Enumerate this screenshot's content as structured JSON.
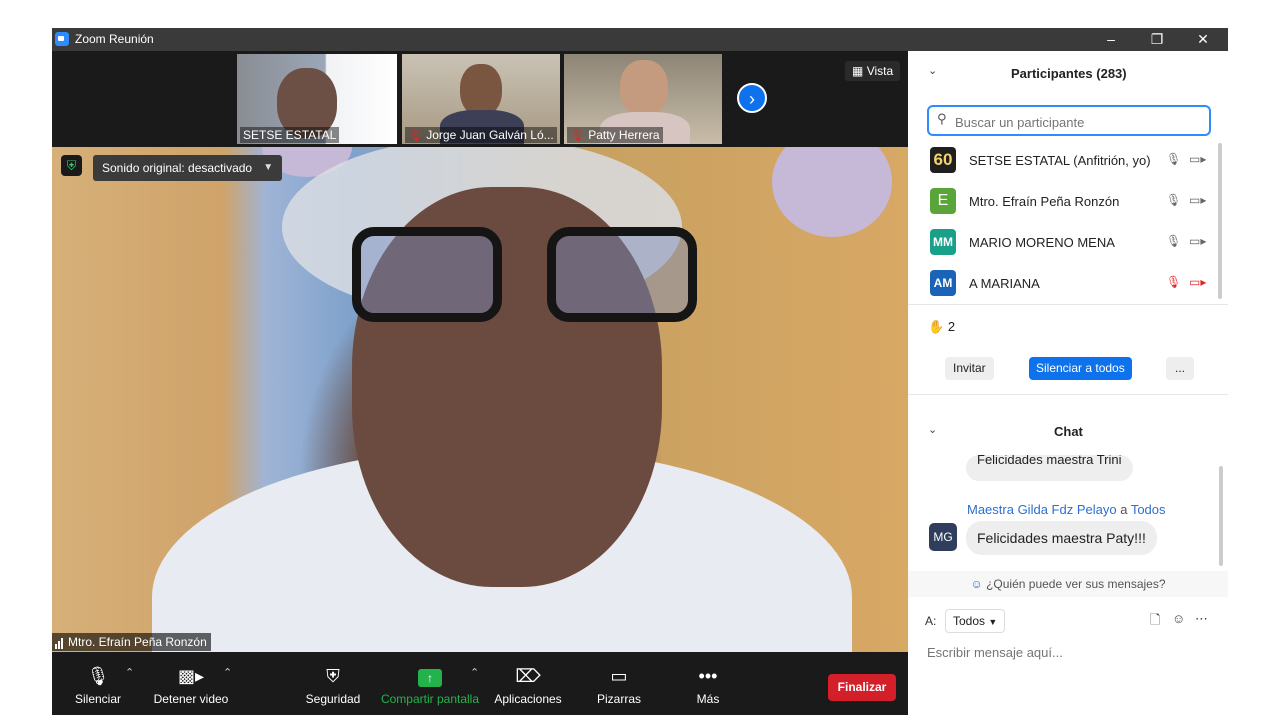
{
  "window": {
    "title": "Zoom Reunión"
  },
  "thumbnails": [
    {
      "name": "SETSE ESTATAL",
      "muted": false
    },
    {
      "name": "Jorge Juan Galván Ló...",
      "muted": true
    },
    {
      "name": "Patty Herrera",
      "muted": true
    }
  ],
  "view_label": "Vista",
  "main_video": {
    "sound_label": "Sonido original: desactivado",
    "speaker_name": "Mtro. Efraín Peña Ronzón"
  },
  "toolbar": {
    "mute": "Silenciar",
    "stop_video": "Detener video",
    "security": "Seguridad",
    "share": "Compartir pantalla",
    "apps": "Aplicaciones",
    "whiteboards": "Pizarras",
    "more": "Más",
    "end": "Finalizar"
  },
  "participants_panel": {
    "title": "Participantes (283)",
    "search_placeholder": "Buscar un participante",
    "items": [
      {
        "avatar": "60",
        "name": "SETSE ESTATAL (Anfitrión, yo)",
        "color": "#1f1f1f",
        "muted": false
      },
      {
        "avatar": "E",
        "name": "Mtro. Efraín Peña Ronzón",
        "color": "#5aa53a",
        "muted": false
      },
      {
        "avatar": "MM",
        "name": "MARIO MORENO MENA",
        "color": "#18a089",
        "muted": false
      },
      {
        "avatar": "AM",
        "name": "A MARIANA",
        "color": "#1b63b8",
        "muted": true
      }
    ],
    "reactions_count": "2",
    "invite": "Invitar",
    "mute_all": "Silenciar a todos",
    "more": "..."
  },
  "chat": {
    "title": "Chat",
    "prev_message": "Felicidades maestra Trini",
    "sender": "Maestra Gilda Fdz Pelayo",
    "to_word": "a",
    "recipient": "Todos",
    "sender_avatar": "MG",
    "message": "Felicidades maestra Paty!!!",
    "who_can_see": "¿Quién puede ver sus mensajes?",
    "to_label": "A:",
    "to_value": "Todos",
    "input_placeholder": "Escribir mensaje aquí..."
  },
  "colors": {
    "accent": "#0e72ed",
    "share_green": "#24b34b",
    "end_red": "#d21f29"
  }
}
